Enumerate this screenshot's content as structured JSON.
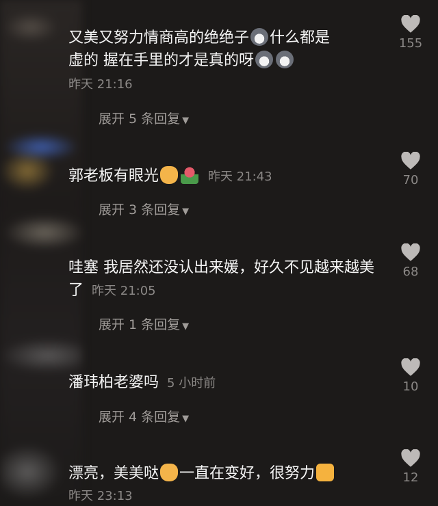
{
  "comments": [
    {
      "text_a": "又美又努力情商高的绝绝子",
      "text_b": "什么都是",
      "text_c": "虚的 握在手里的才是真的呀",
      "time": "昨天 21:16",
      "expand": "展开 5 条回复",
      "likes": "155"
    },
    {
      "text": "郭老板有眼光",
      "time": "昨天 21:43",
      "expand": "展开 3 条回复",
      "likes": "70"
    },
    {
      "text": "哇塞 我居然还没认出来媛，好久不见越来越美了",
      "time": "昨天 21:05",
      "expand": "展开 1 条回复",
      "likes": "68"
    },
    {
      "text": "潘玮柏老婆吗",
      "time": "5 小时前",
      "expand": "展开 4 条回复",
      "likes": "10"
    },
    {
      "text_a": "漂亮，美美哒",
      "text_b": "一直在变好，很努力",
      "time": "昨天 23:13",
      "likes": "12"
    }
  ],
  "icons": {
    "like": "heart-icon",
    "expand": "triangle-down-icon"
  },
  "colors": {
    "text": "#f4f4f4",
    "meta": "#8b8886",
    "heart": "#bdbab8"
  }
}
